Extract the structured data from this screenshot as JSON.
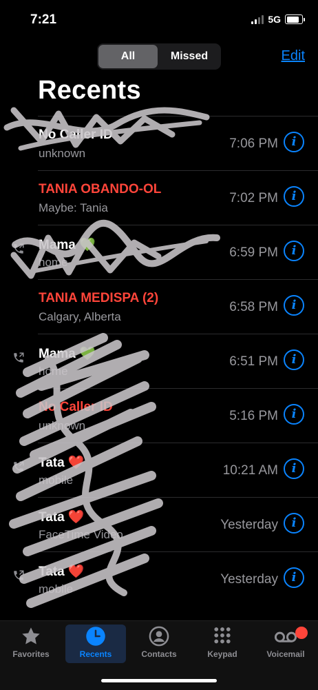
{
  "status_bar": {
    "time": "7:21",
    "network": "5G"
  },
  "segmented_control": {
    "all_label": "All",
    "missed_label": "Missed",
    "selected": "All"
  },
  "header": {
    "edit_label": "Edit",
    "title": "Recents"
  },
  "calls": [
    {
      "name": "No Caller ID",
      "subtitle": "unknown",
      "time": "7:06 PM",
      "missed": false,
      "outgoing": false
    },
    {
      "name": "TANIA OBANDO-OL",
      "subtitle": "Maybe: Tania",
      "time": "7:02 PM",
      "missed": true,
      "outgoing": false
    },
    {
      "name": "Mama 💚",
      "subtitle": "home",
      "time": "6:59 PM",
      "missed": false,
      "outgoing": true
    },
    {
      "name": "TANIA MEDISPA (2)",
      "subtitle": "Calgary, Alberta",
      "time": "6:58 PM",
      "missed": true,
      "outgoing": false
    },
    {
      "name": "Mama 💚",
      "subtitle": "home",
      "time": "6:51 PM",
      "missed": false,
      "outgoing": true
    },
    {
      "name": "No Caller ID",
      "subtitle": "unknown",
      "time": "5:16 PM",
      "missed": true,
      "outgoing": false
    },
    {
      "name": "Tata ❤️",
      "subtitle": "mobile",
      "time": "10:21 AM",
      "missed": false,
      "outgoing": true
    },
    {
      "name": "Tata ❤️",
      "subtitle": "FaceTime Video",
      "time": "Yesterday",
      "missed": false,
      "outgoing": false
    },
    {
      "name": "Tata ❤️",
      "subtitle": "mobile",
      "time": "Yesterday",
      "missed": false,
      "outgoing": true
    }
  ],
  "tab_bar": {
    "tabs": [
      {
        "label": "Favorites",
        "icon": "star-icon"
      },
      {
        "label": "Recents",
        "icon": "clock-icon"
      },
      {
        "label": "Contacts",
        "icon": "person-circle-icon"
      },
      {
        "label": "Keypad",
        "icon": "keypad-icon"
      },
      {
        "label": "Voicemail",
        "icon": "voicemail-icon"
      }
    ],
    "active": "Recents"
  },
  "colors": {
    "accent": "#0a84ff",
    "missed": "#ff453a",
    "background": "#000000",
    "secondary_text": "#98989d"
  }
}
